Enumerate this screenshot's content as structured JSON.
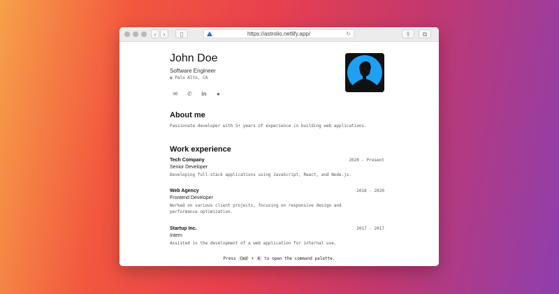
{
  "browser": {
    "url": "https://astrolio.netlify.app/",
    "back_icon": "chevron-left",
    "forward_icon": "chevron-right",
    "sidebar_icon": "sidebar-icon",
    "share_icon": "share-icon",
    "tabs_icon": "tabs-icon",
    "reload_icon": "reload-icon"
  },
  "profile": {
    "name": "John Doe",
    "title": "Software Engineer",
    "location": "Palo Alto, CA",
    "contacts": [
      "mail-icon",
      "phone-icon",
      "linkedin-icon",
      "github-icon"
    ]
  },
  "about": {
    "heading": "About me",
    "text": "Passionate developer with 5+ years of experience in building web applications."
  },
  "work": {
    "heading": "Work experience",
    "items": [
      {
        "company": "Tech Company",
        "role": "Senior Developer",
        "period": "2020 - Present",
        "description": "Developing full-stack applications using JavaScript, React, and Node.js."
      },
      {
        "company": "Web Agency",
        "role": "Frontend Developer",
        "period": "2018 - 2020",
        "description": "Worked on various client projects, focusing on responsive design and performance optimization."
      },
      {
        "company": "Startup Inc.",
        "role": "Intern",
        "period": "2017 - 2017",
        "description": "Assisted in the development of a web application for internal use."
      }
    ]
  },
  "footer": {
    "prefix": "Press",
    "key1": "Cmd",
    "plus": "+",
    "key2": "K",
    "suffix": "to open the command palette."
  },
  "colors": {
    "accent": "#1ea1f2",
    "avatar_bg": "#111111"
  }
}
